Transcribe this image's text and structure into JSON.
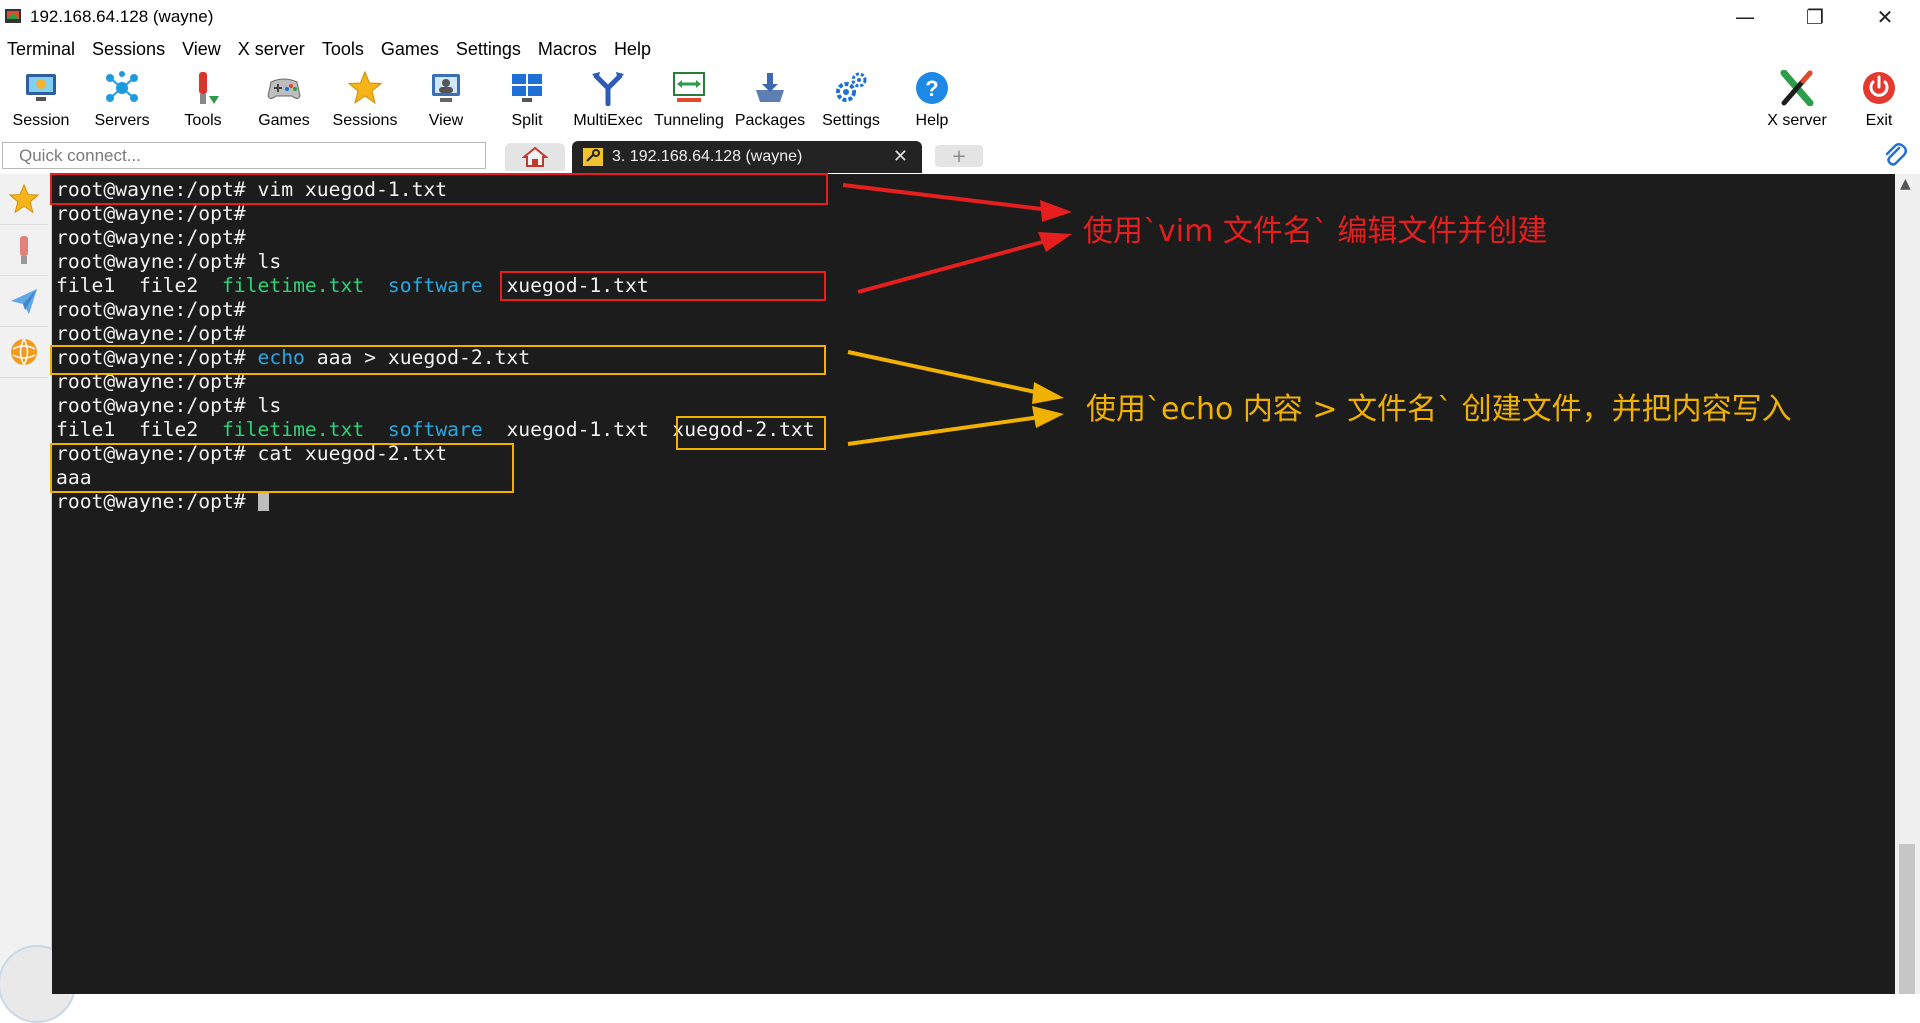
{
  "window": {
    "title": "192.168.64.128 (wayne)",
    "controls": {
      "minimize": "—",
      "restore": "❐",
      "close": "✕"
    }
  },
  "menu": [
    "Terminal",
    "Sessions",
    "View",
    "X server",
    "Tools",
    "Games",
    "Settings",
    "Macros",
    "Help"
  ],
  "toolbar": {
    "items": [
      {
        "label": "Session",
        "icon": "monitor-icon"
      },
      {
        "label": "Servers",
        "icon": "network-icon"
      },
      {
        "label": "Tools",
        "icon": "tools-icon"
      },
      {
        "label": "Games",
        "icon": "gamepad-icon"
      },
      {
        "label": "Sessions",
        "icon": "star-icon"
      },
      {
        "label": "View",
        "icon": "view-icon"
      },
      {
        "label": "Split",
        "icon": "split-icon"
      },
      {
        "label": "MultiExec",
        "icon": "fork-icon"
      },
      {
        "label": "Tunneling",
        "icon": "tunnel-icon"
      },
      {
        "label": "Packages",
        "icon": "package-icon"
      },
      {
        "label": "Settings",
        "icon": "gears-icon"
      },
      {
        "label": "Help",
        "icon": "help-icon"
      }
    ],
    "right": [
      {
        "label": "X server",
        "icon": "x-icon"
      },
      {
        "label": "Exit",
        "icon": "power-icon"
      }
    ]
  },
  "tabs": {
    "quick_connect_placeholder": "Quick connect...",
    "session_tab_label": "3. 192.168.64.128 (wayne)",
    "close_glyph": "✕",
    "new_tab_glyph": "+"
  },
  "terminal": {
    "lines": [
      [
        {
          "t": "root@wayne:/opt# vim xuegod-1.txt"
        }
      ],
      [
        {
          "t": "root@wayne:/opt#"
        }
      ],
      [
        {
          "t": "root@wayne:/opt#"
        }
      ],
      [
        {
          "t": "root@wayne:/opt# ls"
        }
      ],
      [
        {
          "t": "file1  file2  "
        },
        {
          "t": "filetime.txt",
          "c": "green"
        },
        {
          "t": "  "
        },
        {
          "t": "software",
          "c": "blue"
        },
        {
          "t": "  xuegod-1.txt"
        }
      ],
      [
        {
          "t": "root@wayne:/opt#"
        }
      ],
      [
        {
          "t": "root@wayne:/opt#"
        }
      ],
      [
        {
          "t": "root@wayne:/opt# "
        },
        {
          "t": "echo",
          "c": "blue"
        },
        {
          "t": " aaa > xuegod-2.txt"
        }
      ],
      [
        {
          "t": "root@wayne:/opt#"
        }
      ],
      [
        {
          "t": "root@wayne:/opt# ls"
        }
      ],
      [
        {
          "t": "file1  file2  "
        },
        {
          "t": "filetime.txt",
          "c": "green"
        },
        {
          "t": "  "
        },
        {
          "t": "software",
          "c": "blue"
        },
        {
          "t": "  xuegod-1.txt  xuegod-2.txt"
        }
      ],
      [
        {
          "t": "root@wayne:/opt# cat xuegod-2.txt"
        }
      ],
      [
        {
          "t": "aaa"
        }
      ],
      [
        {
          "t": "root@wayne:/opt# "
        },
        {
          "t": "",
          "cursor": true
        }
      ]
    ]
  },
  "annotations": {
    "vim_note": "使用`vim 文件名` 编辑文件并创建",
    "echo_note": "使用`echo 内容 > 文件名` 创建文件，并把内容写入"
  },
  "colors": {
    "terminal_bg": "#1c1c1c",
    "terminal_fg": "#f0f0f0",
    "ls_green": "#2bd37a",
    "ls_blue": "#2aa7e0",
    "annotation_red": "#e61e1e",
    "annotation_yellow": "#f1b100"
  }
}
